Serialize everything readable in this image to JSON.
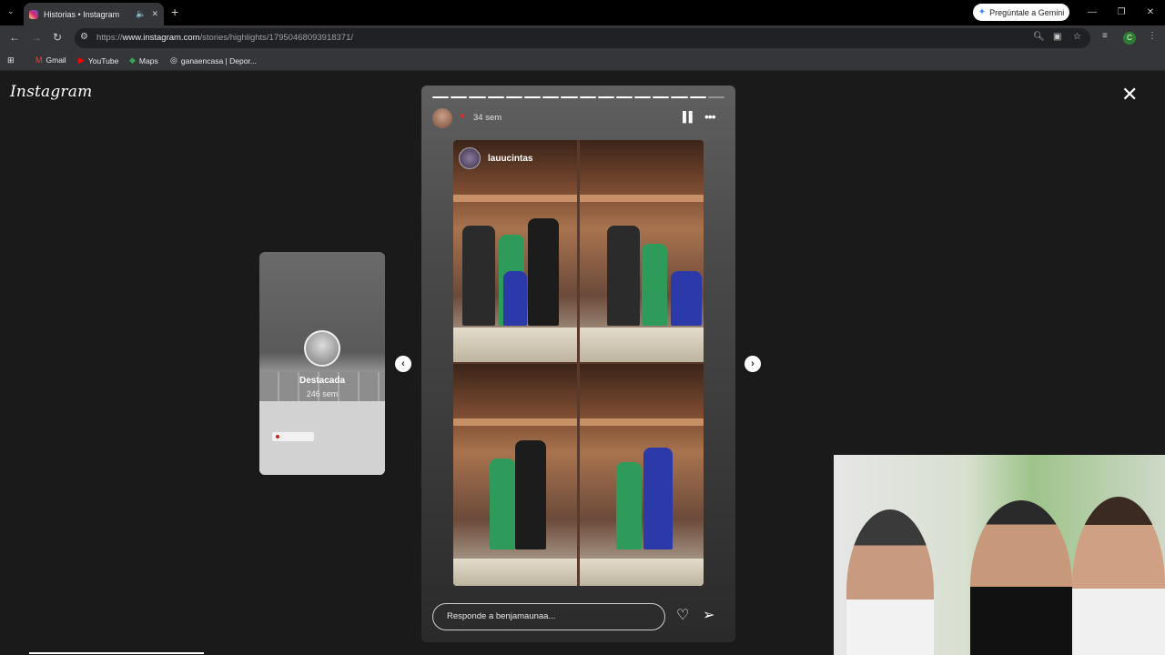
{
  "browser": {
    "tab_title": "Historias • Instagram",
    "new_tab": "+",
    "gemini_label": "Pregúntale a Gemini",
    "url_prefix": "https://",
    "url_host": "www.instagram.com",
    "url_path": "/stories/highlights/17950468093918371/",
    "profile_initial": "C",
    "bookmarks": [
      "Gmail",
      "YouTube",
      "Maps",
      "ganaencasa | Depor..."
    ]
  },
  "instagram": {
    "logo": "Instagram",
    "side_story": {
      "name": "Destacada",
      "time": "246 sem"
    },
    "story": {
      "time": "34 sem",
      "overlay_username": "lauucintas",
      "reply_placeholder": "Responde a benjamaunaa...",
      "progress_total": 16,
      "progress_done": 15
    }
  },
  "icons": [
    "close-icon",
    "chevron-left-icon",
    "chevron-right-icon",
    "pause-icon",
    "more-icon",
    "heart-icon",
    "send-icon"
  ]
}
